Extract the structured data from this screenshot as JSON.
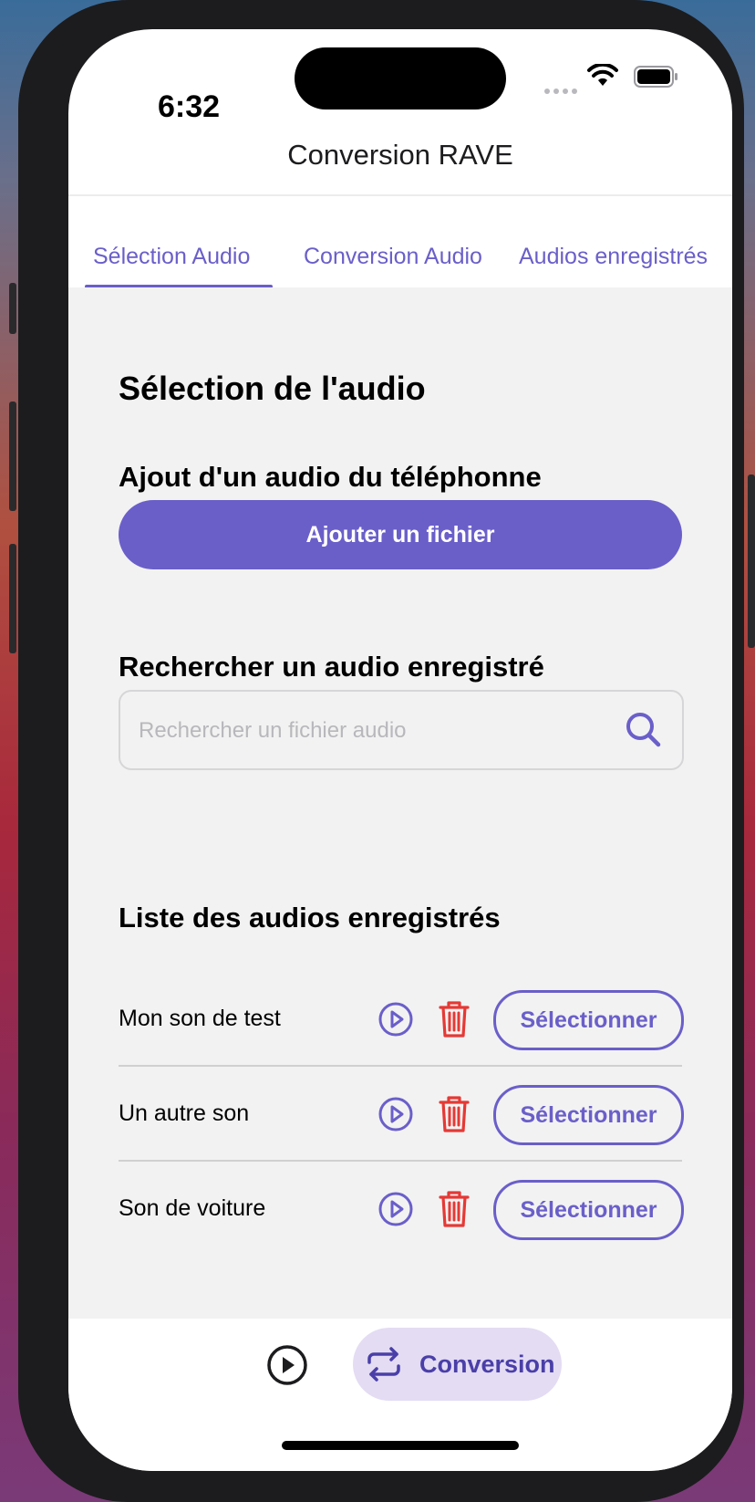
{
  "status_bar": {
    "time": "6:32"
  },
  "header": {
    "title": "Conversion RAVE"
  },
  "tabs": [
    {
      "label": "Sélection Audio",
      "active": true
    },
    {
      "label": "Conversion Audio",
      "active": false
    },
    {
      "label": "Audios enregistrés",
      "active": false
    }
  ],
  "main": {
    "heading": "Sélection de l'audio",
    "add_section": {
      "heading": "Ajout d'un audio du téléphonne",
      "button_label": "Ajouter un fichier"
    },
    "search_section": {
      "heading": "Rechercher un audio enregistré",
      "placeholder": "Rechercher un fichier audio",
      "value": ""
    },
    "list_section": {
      "heading": "Liste des audios enregistrés",
      "items": [
        {
          "name": "Mon son de test",
          "select_label": "Sélectionner"
        },
        {
          "name": "Un autre son",
          "select_label": "Sélectionner"
        },
        {
          "name": "Son de voiture",
          "select_label": "Sélectionner"
        }
      ]
    }
  },
  "bottom_bar": {
    "conversion_label": "Conversion"
  },
  "icons": {
    "search": "search-icon",
    "play": "play-circle-icon",
    "delete": "trash-icon",
    "conversion": "repeat-arrows-icon"
  },
  "colors": {
    "accent": "#6a5fc9",
    "delete": "#e53935",
    "conversion_pill": "#e3dcf3"
  }
}
